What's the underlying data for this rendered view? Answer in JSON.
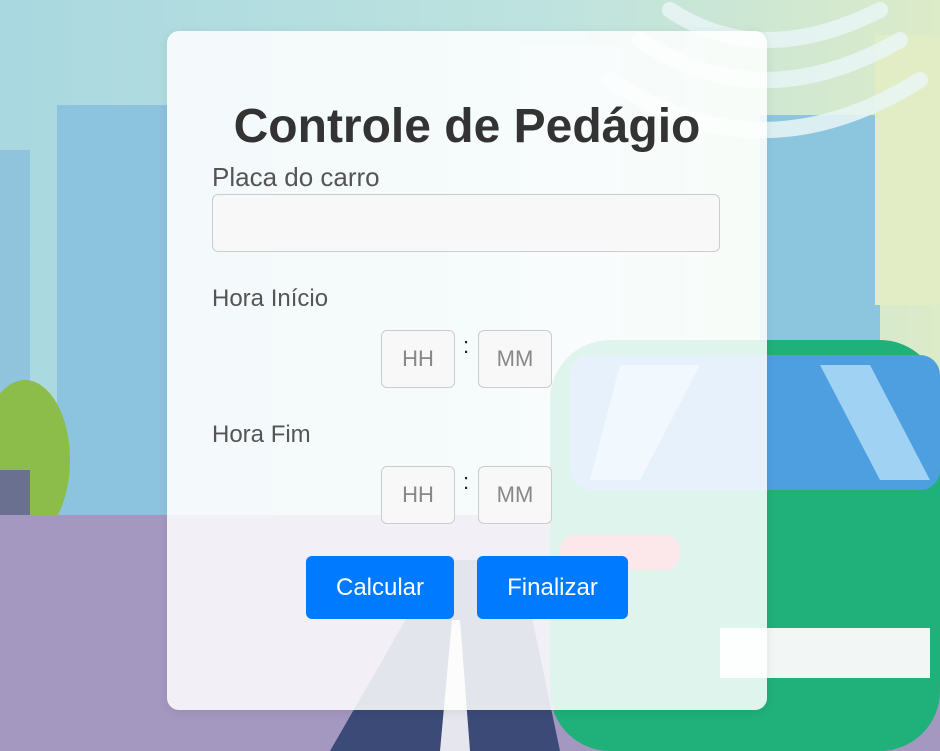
{
  "title": "Controle de Pedágio",
  "plate": {
    "label": "Placa do carro",
    "value": ""
  },
  "start": {
    "label": "Hora Início",
    "hour_placeholder": "HH",
    "minute_placeholder": "MM",
    "separator": ":"
  },
  "end": {
    "label": "Hora Fim",
    "hour_placeholder": "HH",
    "minute_placeholder": "MM",
    "separator": ":"
  },
  "buttons": {
    "calculate": "Calcular",
    "finish": "Finalizar"
  },
  "colors": {
    "accent": "#007bff",
    "title": "#333333",
    "label": "#555555"
  }
}
